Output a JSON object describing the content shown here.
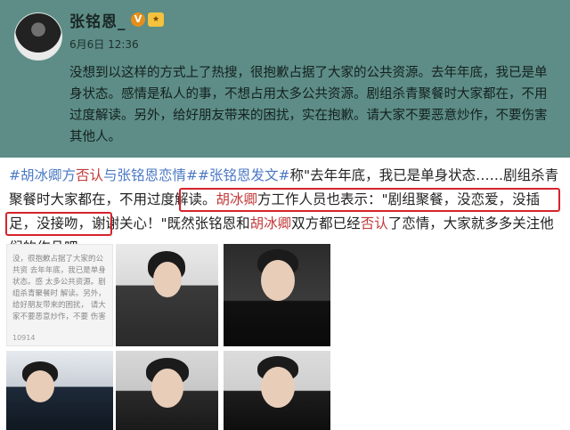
{
  "post": {
    "username": "张铭恩_",
    "badge_v": "V",
    "badge_vip": "★",
    "time": "6月6日 12:36",
    "text": "没想到以这样的方式上了热搜，很抱歉占据了大家的公共资源。去年年底，我已是单身状态。感情是私人的事，不想占用太多公共资源。剧组杀青聚餐时大家都在，不用过度解读。另外，给好朋友带来的困扰，实在抱歉。请大家不要恶意炒作，不要伤害其他人。"
  },
  "article": {
    "hashtag1": "#胡冰卿方",
    "kw_denial1": "否认",
    "hashtag1_rest": "与张铭恩恋情#",
    "hashtag2": "#张铭恩发文#",
    "line1_rest": "称\"去年年底，我已是单身状态……剧组杀青聚餐时大家都在，不用过度解读。",
    "name1": "胡冰卿",
    "staff_said": "方工作人员也表示：\"剧组聚餐，没恋爱，没插足，没接吻，谢谢关心！\"",
    "conclusion1": "既然张铭恩和",
    "name2": "胡冰卿",
    "conclusion2": "双方都已经",
    "kw_denial2": "否认",
    "conclusion3": "了恋情，大家就多多关注他们的作品吧"
  },
  "thumb_text": {
    "lines": "没，很抱歉占据了大家的公共资 去年年底，我已是单身状态。感 太多公共资源。剧组杀青聚餐时 解读。另外，给好朋友带来的困扰， 请大家不要恶意炒作，不要 伤害",
    "count": "10914"
  },
  "colors": {
    "card_bg": "#5d8d86",
    "hashtag": "#4a78c4",
    "keyword_red": "#c23a3a",
    "highlight_box": "#d5242b"
  }
}
